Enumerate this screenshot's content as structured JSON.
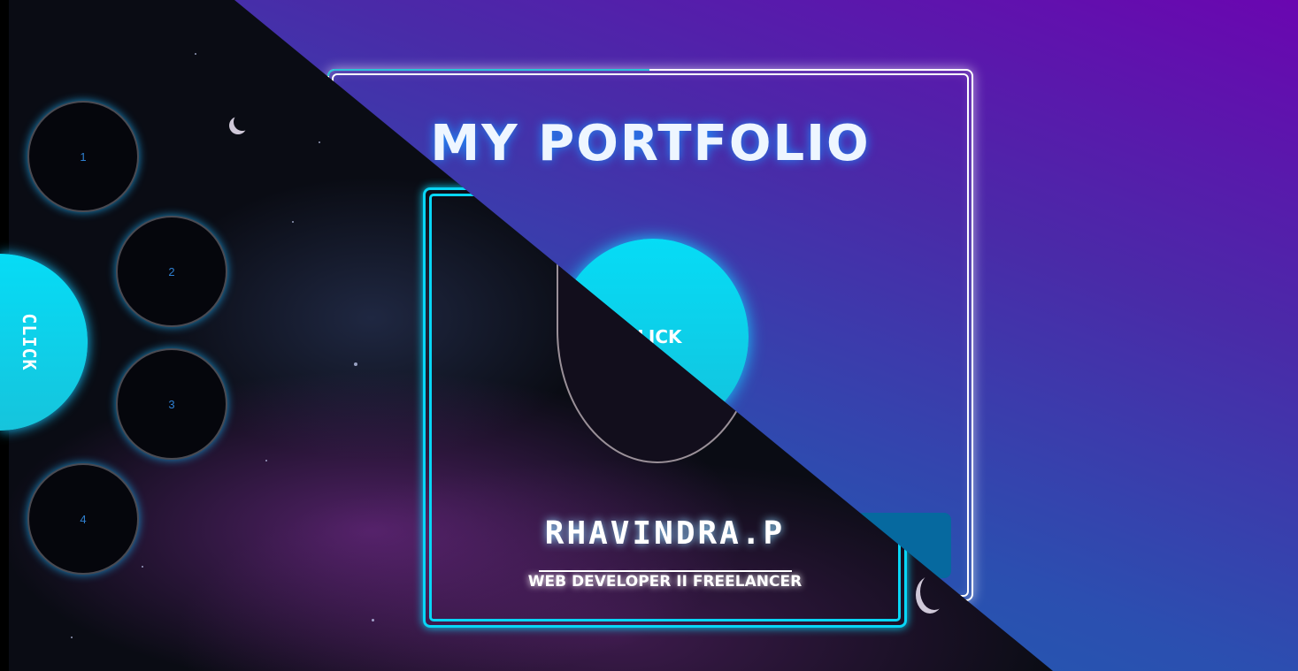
{
  "portfolio": {
    "title": "MY PORTFOLIO",
    "click_label": "CLICK"
  },
  "menu": {
    "toggle_label": "CLICK",
    "items": [
      {
        "label": "1"
      },
      {
        "label": "2"
      },
      {
        "label": "3"
      },
      {
        "label": "4"
      }
    ]
  },
  "profile": {
    "name": "RHAVINDRA.P",
    "subtitle": "WEB DEVELOPER II FREELANCER"
  },
  "colors": {
    "accent": "#08d6f6",
    "button": "#06699f",
    "gradient_top_right": "#6a06b0",
    "gradient_bottom": "#1f5db0",
    "space_bg": "#0a0c14"
  }
}
